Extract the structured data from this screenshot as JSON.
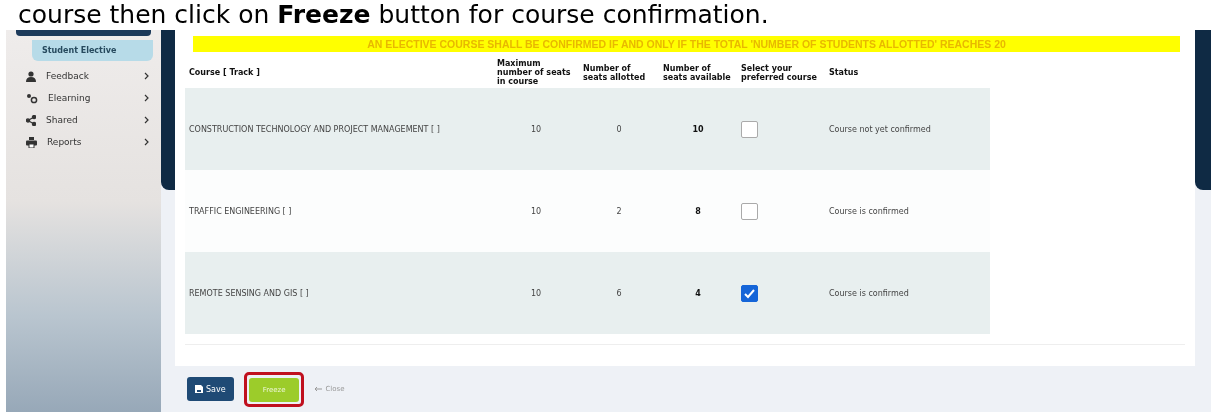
{
  "caption": "course then click on **Freeze** button for course confirmation.",
  "sidebar": {
    "items": [
      {
        "label": "Student Elective",
        "kind": "subitem",
        "selected": true
      },
      {
        "label": "Feedback",
        "kind": "menu",
        "selected": false
      },
      {
        "label": "Elearning",
        "kind": "menu",
        "selected": false
      },
      {
        "label": "Shared",
        "kind": "menu",
        "selected": false
      },
      {
        "label": "Reports",
        "kind": "menu",
        "selected": false
      }
    ]
  },
  "notice": "AN ELECTIVE COURSE SHALL BE CONFIRMED IF AND ONLY IF THE TOTAL 'NUMBER OF STUDENTS ALLOTTED' REACHES 20",
  "table": {
    "columns": [
      "Course [ Track ]",
      "Maximum number of seats in course",
      "Number of seats allotted",
      "Number of seats available",
      "Select your preferred course",
      "Status"
    ],
    "rows": [
      {
        "course": "CONSTRUCTION TECHNOLOGY AND PROJECT MANAGEMENT [ ]",
        "max_seats": "10",
        "allotted": "0",
        "available": "10",
        "checked": false,
        "status": "Course not yet confirmed"
      },
      {
        "course": "TRAFFIC ENGINEERING [ ]",
        "max_seats": "10",
        "allotted": "2",
        "available": "8",
        "checked": false,
        "status": "Course is confirmed"
      },
      {
        "course": "REMOTE SENSING AND GIS [ ]",
        "max_seats": "10",
        "allotted": "6",
        "available": "4",
        "checked": true,
        "status": "Course is confirmed"
      }
    ]
  },
  "footer": {
    "save": "Save",
    "freeze": "Freeze",
    "freeze_highlighted": true,
    "close": "Close"
  }
}
